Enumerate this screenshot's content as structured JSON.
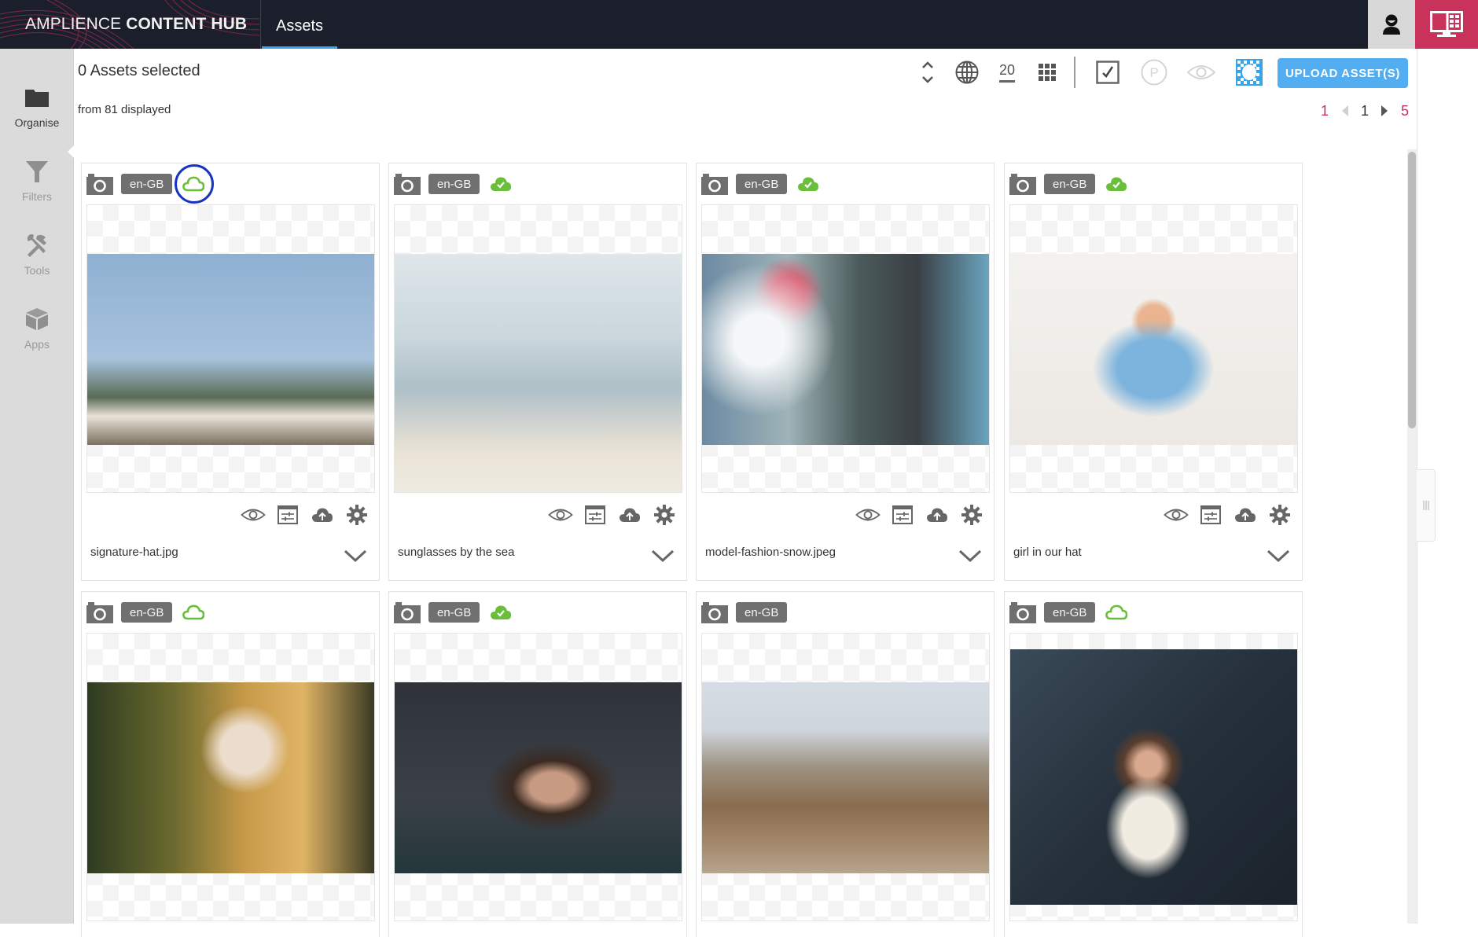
{
  "app": {
    "brand_light": "AMPLIENCE",
    "brand_bold": "CONTENT HUB",
    "active_tab": "Assets",
    "colors": {
      "topbar": "#1b1f2b",
      "accent_blue": "#52aef0",
      "accent_pink": "#c8325b",
      "status_green": "#6abf3a"
    }
  },
  "sidebar": {
    "items": [
      {
        "label": "Organise",
        "icon": "folder-icon",
        "active": true
      },
      {
        "label": "Filters",
        "icon": "filter-icon",
        "active": false
      },
      {
        "label": "Tools",
        "icon": "tools-icon",
        "active": false
      },
      {
        "label": "Apps",
        "icon": "box-icon",
        "active": false
      }
    ]
  },
  "header": {
    "selection": "0 Assets selected",
    "displayed": "from 81 displayed",
    "page_size": "20",
    "upload_label": "UPLOAD ASSET(S)"
  },
  "pagination": {
    "first": "1",
    "current": "1",
    "last": "5"
  },
  "assets": [
    {
      "name": "signature-hat.jpg",
      "locale": "en-GB",
      "status": "cloud-outline",
      "highlighted": true
    },
    {
      "name": "sunglasses by the sea",
      "locale": "en-GB",
      "status": "cloud-check",
      "highlighted": false
    },
    {
      "name": "model-fashion-snow.jpeg",
      "locale": "en-GB",
      "status": "cloud-check",
      "highlighted": false
    },
    {
      "name": "girl in our hat",
      "locale": "en-GB",
      "status": "cloud-check",
      "highlighted": false
    },
    {
      "name": "",
      "locale": "en-GB",
      "status": "cloud-outline",
      "highlighted": false
    },
    {
      "name": "",
      "locale": "en-GB",
      "status": "cloud-check",
      "highlighted": false
    },
    {
      "name": "",
      "locale": "en-GB",
      "status": "none",
      "highlighted": false
    },
    {
      "name": "",
      "locale": "en-GB",
      "status": "cloud-outline",
      "highlighted": false
    }
  ]
}
